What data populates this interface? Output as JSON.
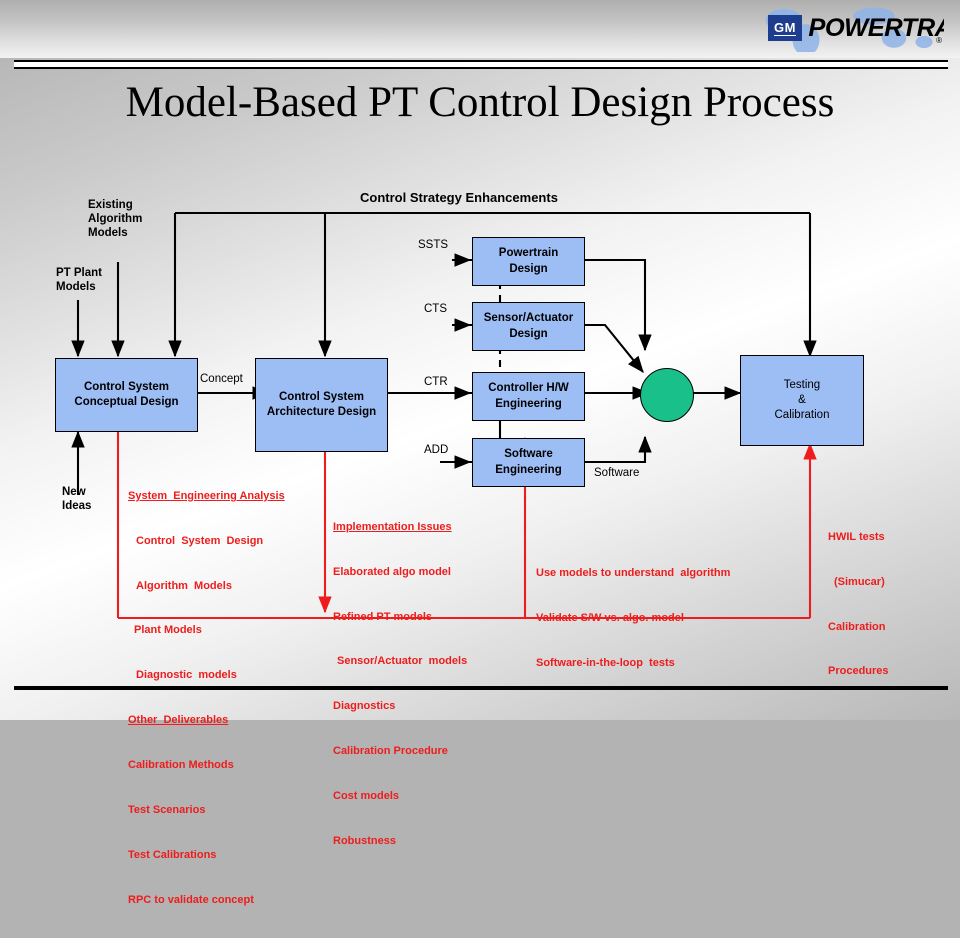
{
  "header": {
    "brand_badge": "GM",
    "brand_word": "POWERTRAIN",
    "brand_reg": "®"
  },
  "title": "Model-Based PT Control Design Process",
  "colors": {
    "node_fill": "#9dbdf5",
    "node_stroke": "#000000",
    "circle_fill": "#19c08a",
    "red": "#ee1c1c",
    "badge_blue": "#1f3d8f"
  },
  "diagram": {
    "top_label": "Control Strategy Enhancements",
    "nodes": [
      {
        "id": "conceptual",
        "lines": [
          "Control  System",
          "Conceptual  Design"
        ]
      },
      {
        "id": "architecture",
        "lines": [
          "Control  System",
          "Architecture  Design"
        ]
      },
      {
        "id": "powertrain",
        "lines": [
          "Powertrain",
          "Design"
        ]
      },
      {
        "id": "sensor",
        "lines": [
          "Sensor/Actuator",
          "Design"
        ]
      },
      {
        "id": "controller",
        "lines": [
          "Controller H/W",
          "Engineering"
        ]
      },
      {
        "id": "software",
        "lines": [
          "Software",
          "Engineering"
        ]
      },
      {
        "id": "testing",
        "lines": [
          "Testing",
          "&",
          "Calibration"
        ]
      }
    ],
    "inputs": [
      {
        "id": "existing-algorithm-models",
        "text": "Existing\nAlgorithm\nModels"
      },
      {
        "id": "pt-plant-models",
        "text": "PT Plant\nModels"
      },
      {
        "id": "new-ideas",
        "text": "New\nIdeas"
      }
    ],
    "edge_labels": [
      {
        "id": "concept",
        "text": "Concept"
      },
      {
        "id": "ssts",
        "text": "SSTS"
      },
      {
        "id": "cts",
        "text": "CTS"
      },
      {
        "id": "ctr",
        "text": "CTR"
      },
      {
        "id": "add",
        "text": "ADD"
      },
      {
        "id": "software-flow",
        "text": "Software"
      }
    ],
    "annotations": [
      {
        "id": "system-engineering-analysis",
        "lines": [
          {
            "text": "System  Engineering Analysis",
            "underline": true,
            "indent": 0
          },
          {
            "text": "Control  System  Design",
            "underline": false,
            "indent": 8
          },
          {
            "text": "Algorithm  Models",
            "underline": false,
            "indent": 8
          },
          {
            "text": "Plant Models",
            "underline": false,
            "indent": 6
          },
          {
            "text": "Diagnostic  models",
            "underline": false,
            "indent": 8
          },
          {
            "text": "Other  Deliverables",
            "underline": true,
            "indent": 0
          },
          {
            "text": "Calibration Methods",
            "underline": false,
            "indent": 0
          },
          {
            "text": "Test Scenarios",
            "underline": false,
            "indent": 0
          },
          {
            "text": "Test Calibrations",
            "underline": false,
            "indent": 0
          },
          {
            "text": "RPC to validate concept",
            "underline": false,
            "indent": 0
          }
        ]
      },
      {
        "id": "implementation-issues",
        "lines": [
          {
            "text": "Implementation Issues",
            "underline": true,
            "indent": 0
          },
          {
            "text": "Elaborated algo model",
            "underline": false,
            "indent": 0
          },
          {
            "text": "Refined PT models",
            "underline": false,
            "indent": 0
          },
          {
            "text": "Sensor/Actuator  models",
            "underline": false,
            "indent": 4
          },
          {
            "text": "Diagnostics",
            "underline": false,
            "indent": 0
          },
          {
            "text": "Calibration Procedure",
            "underline": false,
            "indent": 0
          },
          {
            "text": "Cost models",
            "underline": false,
            "indent": 0
          },
          {
            "text": "Robustness",
            "underline": false,
            "indent": 0
          }
        ]
      },
      {
        "id": "model-usage",
        "lines": [
          {
            "text": "Use models to understand  algorithm",
            "underline": false,
            "indent": 0
          },
          {
            "text": "Validate S/W vs. algo. model",
            "underline": false,
            "indent": 0
          },
          {
            "text": "Software-in-the-loop  tests",
            "underline": false,
            "indent": 0
          }
        ]
      },
      {
        "id": "hwil-tests",
        "lines": [
          {
            "text": "HWIL tests",
            "underline": false,
            "indent": 0
          },
          {
            "text": "(Simucar)",
            "underline": false,
            "indent": 0
          },
          {
            "text": "Calibration",
            "underline": false,
            "indent": 0
          },
          {
            "text": "Procedures",
            "underline": false,
            "indent": 0
          }
        ]
      }
    ]
  }
}
